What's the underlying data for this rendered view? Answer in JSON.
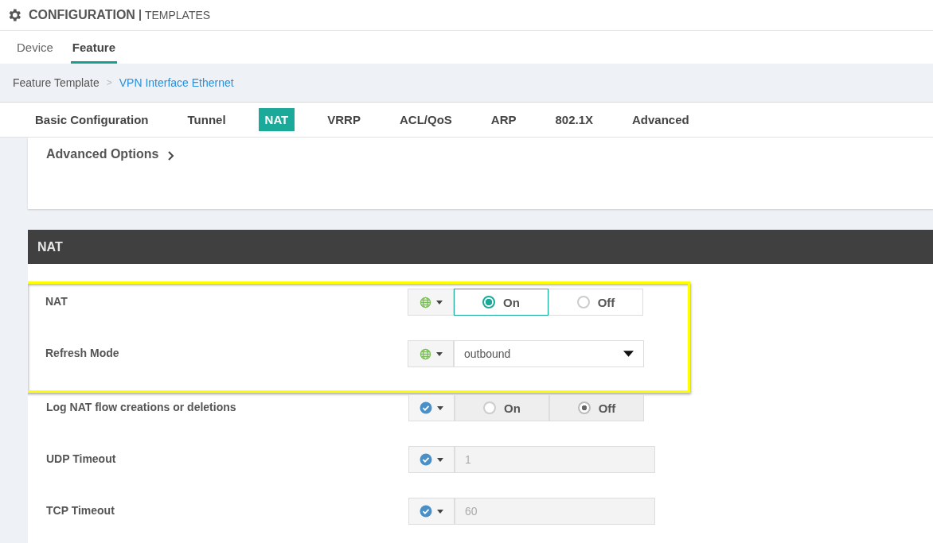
{
  "header": {
    "title": "CONFIGURATION",
    "subtitle": "TEMPLATES"
  },
  "tabs": [
    {
      "label": "Device",
      "selected": false
    },
    {
      "label": "Feature",
      "selected": true
    }
  ],
  "breadcrumb": [
    {
      "label": "Feature Template",
      "current": false
    },
    {
      "label": "VPN Interface Ethernet",
      "current": true
    }
  ],
  "breadcrumb_separator": ">",
  "section_tabs": [
    {
      "label": "Basic Configuration",
      "selected": false
    },
    {
      "label": "Tunnel",
      "selected": false
    },
    {
      "label": "NAT",
      "selected": true
    },
    {
      "label": "VRRP",
      "selected": false
    },
    {
      "label": "ACL/QoS",
      "selected": false
    },
    {
      "label": "ARP",
      "selected": false
    },
    {
      "label": "802.1X",
      "selected": false
    },
    {
      "label": "Advanced",
      "selected": false
    }
  ],
  "advanced_options": {
    "label": "Advanced Options",
    "expanded": false
  },
  "section": {
    "title": "NAT"
  },
  "rows": [
    {
      "label": "NAT",
      "global_scope": true,
      "highlighted": true,
      "kind": "radio",
      "disabled": false,
      "options": [
        {
          "label": "On",
          "selected": true
        },
        {
          "label": "Off",
          "selected": false
        }
      ]
    },
    {
      "label": "Refresh Mode",
      "global_scope": true,
      "highlighted": true,
      "kind": "select",
      "disabled": false,
      "value": "outbound"
    },
    {
      "label": "Log NAT flow creations or deletions",
      "global_scope": false,
      "highlighted": false,
      "kind": "radio",
      "disabled": true,
      "options": [
        {
          "label": "On",
          "selected": false
        },
        {
          "label": "Off",
          "selected": true
        }
      ]
    },
    {
      "label": "UDP Timeout",
      "global_scope": false,
      "highlighted": false,
      "kind": "text",
      "disabled": true,
      "value": "1"
    },
    {
      "label": "TCP Timeout",
      "global_scope": false,
      "highlighted": false,
      "kind": "text",
      "disabled": true,
      "value": "60"
    }
  ]
}
